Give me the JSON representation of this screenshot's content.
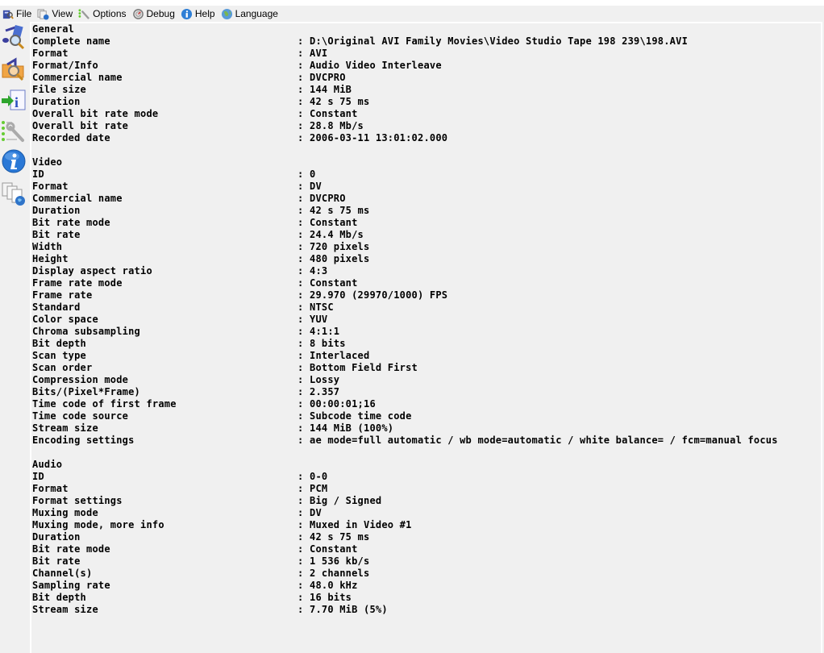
{
  "menu": [
    {
      "label": "File",
      "icon": "file-icon"
    },
    {
      "label": "View",
      "icon": "view-icon"
    },
    {
      "label": "Options",
      "icon": "options-icon"
    },
    {
      "label": "Debug",
      "icon": "debug-icon"
    },
    {
      "label": "Help",
      "icon": "help-icon"
    },
    {
      "label": "Language",
      "icon": "language-icon"
    }
  ],
  "sidebar": [
    {
      "name": "open-file-button",
      "icon": "media-file-search-icon"
    },
    {
      "name": "open-folder-button",
      "icon": "folder-search-icon"
    },
    {
      "name": "export-button",
      "icon": "export-info-icon"
    },
    {
      "name": "preferences-button",
      "icon": "settings-wrench-icon"
    },
    {
      "name": "about-button",
      "icon": "info-icon"
    },
    {
      "name": "website-button",
      "icon": "web-docs-icon"
    }
  ],
  "sections": [
    {
      "title": "General",
      "rows": [
        {
          "label": "Complete name",
          "value": "D:\\Original AVI Family Movies\\Video Studio Tape 198 239\\198.AVI"
        },
        {
          "label": "Format",
          "value": "AVI"
        },
        {
          "label": "Format/Info",
          "value": "Audio Video Interleave"
        },
        {
          "label": "Commercial name",
          "value": "DVCPRO"
        },
        {
          "label": "File size",
          "value": "144 MiB"
        },
        {
          "label": "Duration",
          "value": "42 s 75 ms"
        },
        {
          "label": "Overall bit rate mode",
          "value": "Constant"
        },
        {
          "label": "Overall bit rate",
          "value": "28.8 Mb/s"
        },
        {
          "label": "Recorded date",
          "value": "2006-03-11 13:01:02.000"
        }
      ]
    },
    {
      "title": "Video",
      "rows": [
        {
          "label": "ID",
          "value": "0"
        },
        {
          "label": "Format",
          "value": "DV"
        },
        {
          "label": "Commercial name",
          "value": "DVCPRO"
        },
        {
          "label": "Duration",
          "value": "42 s 75 ms"
        },
        {
          "label": "Bit rate mode",
          "value": "Constant"
        },
        {
          "label": "Bit rate",
          "value": "24.4 Mb/s"
        },
        {
          "label": "Width",
          "value": "720 pixels"
        },
        {
          "label": "Height",
          "value": "480 pixels"
        },
        {
          "label": "Display aspect ratio",
          "value": "4:3"
        },
        {
          "label": "Frame rate mode",
          "value": "Constant"
        },
        {
          "label": "Frame rate",
          "value": "29.970 (29970/1000) FPS"
        },
        {
          "label": "Standard",
          "value": "NTSC"
        },
        {
          "label": "Color space",
          "value": "YUV"
        },
        {
          "label": "Chroma subsampling",
          "value": "4:1:1"
        },
        {
          "label": "Bit depth",
          "value": "8 bits"
        },
        {
          "label": "Scan type",
          "value": "Interlaced"
        },
        {
          "label": "Scan order",
          "value": "Bottom Field First"
        },
        {
          "label": "Compression mode",
          "value": "Lossy"
        },
        {
          "label": "Bits/(Pixel*Frame)",
          "value": "2.357"
        },
        {
          "label": "Time code of first frame",
          "value": "00:00:01;16"
        },
        {
          "label": "Time code source",
          "value": "Subcode time code"
        },
        {
          "label": "Stream size",
          "value": "144 MiB (100%)"
        },
        {
          "label": "Encoding settings",
          "value": "ae mode=full automatic / wb mode=automatic / white balance= / fcm=manual focus"
        }
      ]
    },
    {
      "title": "Audio",
      "rows": [
        {
          "label": "ID",
          "value": "0-0"
        },
        {
          "label": "Format",
          "value": "PCM"
        },
        {
          "label": "Format settings",
          "value": "Big / Signed"
        },
        {
          "label": "Muxing mode",
          "value": "DV"
        },
        {
          "label": "Muxing mode, more info",
          "value": "Muxed in Video #1"
        },
        {
          "label": "Duration",
          "value": "42 s 75 ms"
        },
        {
          "label": "Bit rate mode",
          "value": "Constant"
        },
        {
          "label": "Bit rate",
          "value": "1 536 kb/s"
        },
        {
          "label": "Channel(s)",
          "value": "2 channels"
        },
        {
          "label": "Sampling rate",
          "value": "48.0 kHz"
        },
        {
          "label": "Bit depth",
          "value": "16 bits"
        },
        {
          "label": "Stream size",
          "value": "7.70 MiB (5%)"
        }
      ]
    }
  ],
  "separator": ":"
}
